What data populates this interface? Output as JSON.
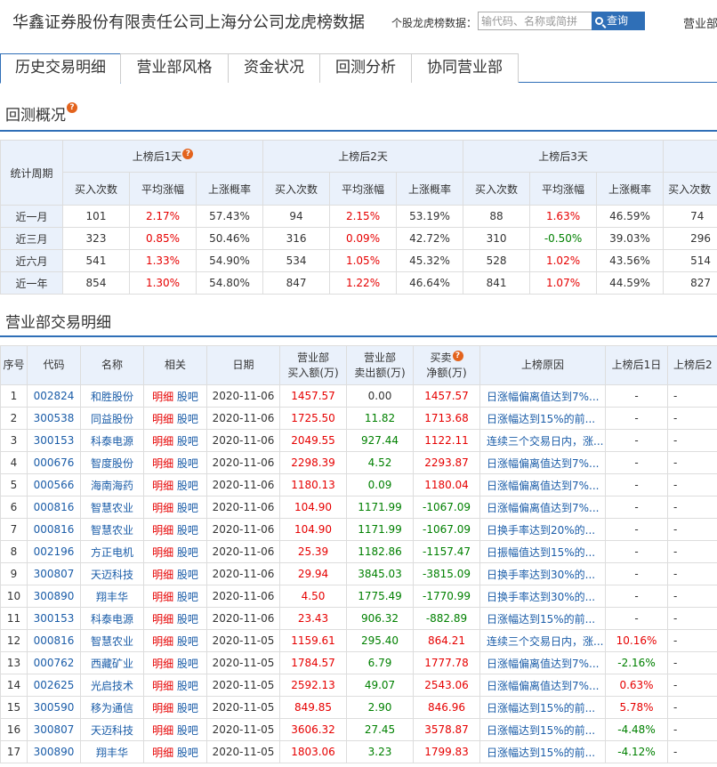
{
  "header": {
    "title": "华鑫证券股份有限责任公司上海分公司龙虎榜数据",
    "search_label": "个股龙虎榜数据：",
    "search_placeholder": "输代码、名称或简拼",
    "search_button": "查询",
    "nav_right": "营业部"
  },
  "tabs": [
    "历史交易明细",
    "营业部风格",
    "资金状况",
    "回测分析",
    "协同营业部"
  ],
  "backtest": {
    "title": "回测概况",
    "period_header": "统计周期",
    "groups": [
      "上榜后1天",
      "上榜后2天",
      "上榜后3天"
    ],
    "subheaders": [
      "买入次数",
      "平均涨幅",
      "上涨概率"
    ],
    "extra_subheader": "买入次数",
    "rows": [
      {
        "label": "近一月",
        "cells": [
          "101",
          "2.17%",
          "57.43%",
          "94",
          "2.15%",
          "53.19%",
          "88",
          "1.63%",
          "46.59%",
          "74"
        ]
      },
      {
        "label": "近三月",
        "cells": [
          "323",
          "0.85%",
          "50.46%",
          "316",
          "0.09%",
          "42.72%",
          "310",
          "-0.50%",
          "39.03%",
          "296"
        ]
      },
      {
        "label": "近六月",
        "cells": [
          "541",
          "1.33%",
          "54.90%",
          "534",
          "1.05%",
          "45.32%",
          "528",
          "1.02%",
          "43.56%",
          "514"
        ]
      },
      {
        "label": "近一年",
        "cells": [
          "854",
          "1.30%",
          "54.80%",
          "847",
          "1.22%",
          "46.64%",
          "841",
          "1.07%",
          "44.59%",
          "827"
        ]
      }
    ]
  },
  "detail": {
    "title": "营业部交易明细",
    "headers": {
      "seq": "序号",
      "code": "代码",
      "name": "名称",
      "related": "相关",
      "date": "日期",
      "buy_l1": "营业部",
      "buy_l2": "买入额(万)",
      "sell_l1": "营业部",
      "sell_l2": "卖出额(万)",
      "net_l1": "买卖",
      "net_l2": "净额(万)",
      "reason": "上榜原因",
      "d1": "上榜后1日",
      "d2": "上榜后2"
    },
    "link_detail": "明细",
    "link_guba": "股吧",
    "rows": [
      {
        "seq": "1",
        "code": "002824",
        "name": "和胜股份",
        "date": "2020-11-06",
        "buy": "1457.57",
        "sell": "0.00",
        "net": "1457.57",
        "reason": "日涨幅偏离值达到7%...",
        "d1": "-",
        "d2": "-"
      },
      {
        "seq": "2",
        "code": "300538",
        "name": "同益股份",
        "date": "2020-11-06",
        "buy": "1725.50",
        "sell": "11.82",
        "net": "1713.68",
        "reason": "日涨幅达到15%的前...",
        "d1": "-",
        "d2": "-"
      },
      {
        "seq": "3",
        "code": "300153",
        "name": "科泰电源",
        "date": "2020-11-06",
        "buy": "2049.55",
        "sell": "927.44",
        "net": "1122.11",
        "reason": "连续三个交易日内，涨...",
        "d1": "-",
        "d2": "-"
      },
      {
        "seq": "4",
        "code": "000676",
        "name": "智度股份",
        "date": "2020-11-06",
        "buy": "2298.39",
        "sell": "4.52",
        "net": "2293.87",
        "reason": "日涨幅偏离值达到7%...",
        "d1": "-",
        "d2": "-"
      },
      {
        "seq": "5",
        "code": "000566",
        "name": "海南海药",
        "date": "2020-11-06",
        "buy": "1180.13",
        "sell": "0.09",
        "net": "1180.04",
        "reason": "日涨幅偏离值达到7%...",
        "d1": "-",
        "d2": "-"
      },
      {
        "seq": "6",
        "code": "000816",
        "name": "智慧农业",
        "date": "2020-11-06",
        "buy": "104.90",
        "sell": "1171.99",
        "net": "-1067.09",
        "reason": "日涨幅偏离值达到7%...",
        "d1": "-",
        "d2": "-"
      },
      {
        "seq": "7",
        "code": "000816",
        "name": "智慧农业",
        "date": "2020-11-06",
        "buy": "104.90",
        "sell": "1171.99",
        "net": "-1067.09",
        "reason": "日换手率达到20%的...",
        "d1": "-",
        "d2": "-"
      },
      {
        "seq": "8",
        "code": "002196",
        "name": "方正电机",
        "date": "2020-11-06",
        "buy": "25.39",
        "sell": "1182.86",
        "net": "-1157.47",
        "reason": "日振幅值达到15%的...",
        "d1": "-",
        "d2": "-"
      },
      {
        "seq": "9",
        "code": "300807",
        "name": "天迈科技",
        "date": "2020-11-06",
        "buy": "29.94",
        "sell": "3845.03",
        "net": "-3815.09",
        "reason": "日换手率达到30%的...",
        "d1": "-",
        "d2": "-"
      },
      {
        "seq": "10",
        "code": "300890",
        "name": "翔丰华",
        "date": "2020-11-06",
        "buy": "4.50",
        "sell": "1775.49",
        "net": "-1770.99",
        "reason": "日换手率达到30%的...",
        "d1": "-",
        "d2": "-"
      },
      {
        "seq": "11",
        "code": "300153",
        "name": "科泰电源",
        "date": "2020-11-06",
        "buy": "23.43",
        "sell": "906.32",
        "net": "-882.89",
        "reason": "日涨幅达到15%的前...",
        "d1": "-",
        "d2": "-"
      },
      {
        "seq": "12",
        "code": "000816",
        "name": "智慧农业",
        "date": "2020-11-05",
        "buy": "1159.61",
        "sell": "295.40",
        "net": "864.21",
        "reason": "连续三个交易日内，涨...",
        "d1": "10.16%",
        "d2": "-"
      },
      {
        "seq": "13",
        "code": "000762",
        "name": "西藏矿业",
        "date": "2020-11-05",
        "buy": "1784.57",
        "sell": "6.79",
        "net": "1777.78",
        "reason": "日涨幅偏离值达到7%...",
        "d1": "-2.16%",
        "d2": "-"
      },
      {
        "seq": "14",
        "code": "002625",
        "name": "光启技术",
        "date": "2020-11-05",
        "buy": "2592.13",
        "sell": "49.07",
        "net": "2543.06",
        "reason": "日涨幅偏离值达到7%...",
        "d1": "0.63%",
        "d2": "-"
      },
      {
        "seq": "15",
        "code": "300590",
        "name": "移为通信",
        "date": "2020-11-05",
        "buy": "849.85",
        "sell": "2.90",
        "net": "846.96",
        "reason": "日涨幅达到15%的前...",
        "d1": "5.78%",
        "d2": "-"
      },
      {
        "seq": "16",
        "code": "300807",
        "name": "天迈科技",
        "date": "2020-11-05",
        "buy": "3606.32",
        "sell": "27.45",
        "net": "3578.87",
        "reason": "日涨幅达到15%的前...",
        "d1": "-4.48%",
        "d2": "-"
      },
      {
        "seq": "17",
        "code": "300890",
        "name": "翔丰华",
        "date": "2020-11-05",
        "buy": "1803.06",
        "sell": "3.23",
        "net": "1799.83",
        "reason": "日涨幅达到15%的前...",
        "d1": "-4.12%",
        "d2": "-"
      }
    ]
  }
}
